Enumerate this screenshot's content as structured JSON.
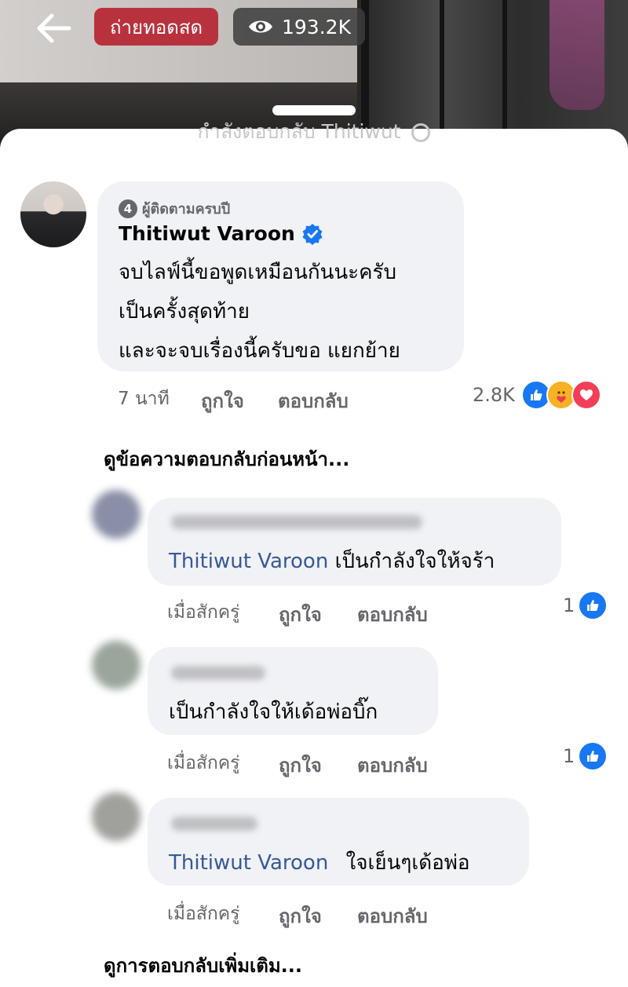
{
  "live": {
    "badge": "ถ่ายทอดสด",
    "views": "193.2K"
  },
  "sheet": {
    "title": "กำลังตอบกลับ Thitiwut"
  },
  "main_comment": {
    "badge": "ผู้ติดตามครบปี",
    "badge_level": "4",
    "author": "Thitiwut Varoon",
    "verified": true,
    "lines": [
      "จบไลฟ์นี้ขอพูดเหมือนกันนะครับ",
      "เป็นครั้งสุดท้าย",
      "และจะจบเรื่องนี้ครับขอ แยกย้าย"
    ],
    "time": "7 นาที",
    "like_label": "ถูกใจ",
    "reply_label": "ตอบกลับ",
    "reaction_count": "2.8K",
    "reactions": [
      "like-icon",
      "care-icon",
      "love-icon"
    ]
  },
  "view_previous": "ดูข้อความตอบกลับก่อนหน้า...",
  "replies": [
    {
      "mention": "Thitiwut Varoon",
      "text": "เป็นกำลังใจให้จร้า",
      "time": "เมื่อสักครู่",
      "like_label": "ถูกใจ",
      "reply_label": "ตอบกลับ",
      "reaction_count": "1"
    },
    {
      "mention": "",
      "text": "เป็นกำลังใจให้เด้อพ่อบิ๊ก",
      "time": "เมื่อสักครู่",
      "like_label": "ถูกใจ",
      "reply_label": "ตอบกลับ",
      "reaction_count": "1"
    },
    {
      "mention": "Thitiwut Varoon",
      "text": "ใจเย็นๆเด้อพ่อ",
      "time": "เมื่อสักครู่",
      "like_label": "ถูกใจ",
      "reply_label": "ตอบกลับ",
      "reaction_count": ""
    }
  ],
  "view_more": "ดูการตอบกลับเพิ่มเติม...",
  "colors": {
    "accent": "#1877f2",
    "mention": "#385898",
    "live": "#b8323d",
    "bubble": "#f0f2f5"
  }
}
